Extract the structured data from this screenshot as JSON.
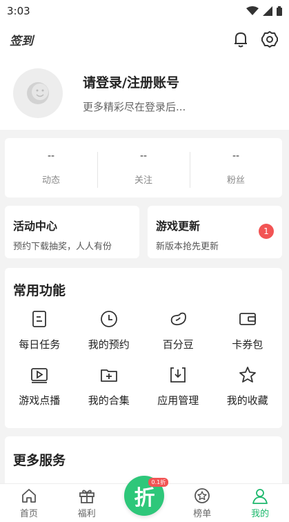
{
  "status_bar": {
    "time": "3:03"
  },
  "top_bar": {
    "checkin_label": "签到"
  },
  "profile": {
    "title": "请登录/注册账号",
    "subtitle": "更多精彩尽在登录后..."
  },
  "stats": [
    {
      "value": "--",
      "label": "动态"
    },
    {
      "value": "--",
      "label": "关注"
    },
    {
      "value": "--",
      "label": "粉丝"
    }
  ],
  "promo_cards": {
    "activity": {
      "title": "活动中心",
      "subtitle": "预约下载抽奖，人人有份"
    },
    "updates": {
      "title": "游戏更新",
      "subtitle": "新版本抢先更新",
      "badge": "1"
    }
  },
  "features": {
    "title": "常用功能",
    "items": [
      {
        "label": "每日任务",
        "icon": "task-list-icon"
      },
      {
        "label": "我的预约",
        "icon": "clock-icon"
      },
      {
        "label": "百分豆",
        "icon": "bean-icon"
      },
      {
        "label": "卡券包",
        "icon": "wallet-icon"
      },
      {
        "label": "游戏点播",
        "icon": "video-play-icon"
      },
      {
        "label": "我的合集",
        "icon": "folder-add-icon"
      },
      {
        "label": "应用管理",
        "icon": "download-icon"
      },
      {
        "label": "我的收藏",
        "icon": "star-icon"
      }
    ]
  },
  "more_services": {
    "title": "更多服务"
  },
  "tabbar": {
    "home": "首页",
    "welfare": "福利",
    "discount": "折",
    "discount_tag": "0.1折",
    "ranking": "榜单",
    "mine": "我的"
  },
  "colors": {
    "accent": "#1cb86c",
    "badge": "#f25454"
  }
}
